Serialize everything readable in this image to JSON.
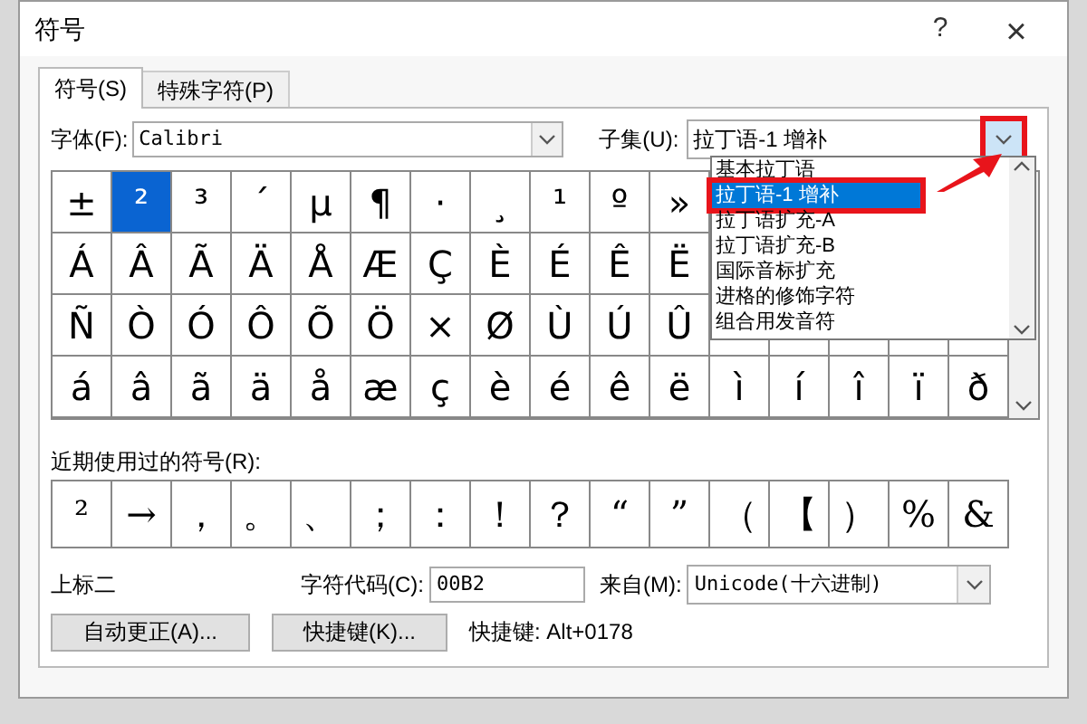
{
  "window": {
    "title": "符号",
    "help": "?",
    "close": "×"
  },
  "tabs": [
    {
      "label": "符号(S)",
      "selected": true
    },
    {
      "label": "特殊字符(P)",
      "selected": false
    }
  ],
  "font": {
    "label": "字体(F):",
    "value": "Calibri"
  },
  "subset": {
    "label": "子集(U):",
    "value": "拉丁语-1 增补",
    "expanded": true,
    "options": [
      {
        "label": "基本拉丁语",
        "selected": false
      },
      {
        "label": "拉丁语-1 增补",
        "selected": true
      },
      {
        "label": "拉丁语扩充-A",
        "selected": false
      },
      {
        "label": "拉丁语扩充-B",
        "selected": false
      },
      {
        "label": "国际音标扩充",
        "selected": false
      },
      {
        "label": "进格的修饰字符",
        "selected": false
      },
      {
        "label": "组合用发音符",
        "selected": false
      }
    ]
  },
  "symbol_grid": {
    "rows": [
      [
        {
          "c": "±",
          "selected": false
        },
        {
          "c": "²",
          "selected": true
        },
        {
          "c": "³",
          "selected": false
        },
        {
          "c": "´",
          "selected": false
        },
        {
          "c": "µ",
          "selected": false
        },
        {
          "c": "¶",
          "selected": false
        },
        {
          "c": "·",
          "selected": false
        },
        {
          "c": "¸",
          "selected": false
        },
        {
          "c": "¹",
          "selected": false
        },
        {
          "c": "º",
          "selected": false
        },
        {
          "c": "»",
          "selected": false
        }
      ],
      [
        {
          "c": "Á",
          "selected": false
        },
        {
          "c": "Â",
          "selected": false
        },
        {
          "c": "Ã",
          "selected": false
        },
        {
          "c": "Ä",
          "selected": false
        },
        {
          "c": "Å",
          "selected": false
        },
        {
          "c": "Æ",
          "selected": false
        },
        {
          "c": "Ç",
          "selected": false
        },
        {
          "c": "È",
          "selected": false
        },
        {
          "c": "É",
          "selected": false
        },
        {
          "c": "Ê",
          "selected": false
        },
        {
          "c": "Ë",
          "selected": false
        }
      ],
      [
        {
          "c": "Ñ",
          "selected": false
        },
        {
          "c": "Ò",
          "selected": false
        },
        {
          "c": "Ó",
          "selected": false
        },
        {
          "c": "Ô",
          "selected": false
        },
        {
          "c": "Õ",
          "selected": false
        },
        {
          "c": "Ö",
          "selected": false
        },
        {
          "c": "×",
          "selected": false
        },
        {
          "c": "Ø",
          "selected": false
        },
        {
          "c": "Ù",
          "selected": false
        },
        {
          "c": "Ú",
          "selected": false
        },
        {
          "c": "Û",
          "selected": false
        }
      ],
      [
        {
          "c": "á",
          "selected": false
        },
        {
          "c": "â",
          "selected": false
        },
        {
          "c": "ã",
          "selected": false
        },
        {
          "c": "ä",
          "selected": false
        },
        {
          "c": "å",
          "selected": false
        },
        {
          "c": "æ",
          "selected": false
        },
        {
          "c": "ç",
          "selected": false
        },
        {
          "c": "è",
          "selected": false
        },
        {
          "c": "é",
          "selected": false
        },
        {
          "c": "ê",
          "selected": false
        },
        {
          "c": "ë",
          "selected": false
        },
        {
          "c": "ì",
          "selected": false
        },
        {
          "c": "í",
          "selected": false
        },
        {
          "c": "î",
          "selected": false
        },
        {
          "c": "ï",
          "selected": false
        },
        {
          "c": "ð",
          "selected": false
        }
      ]
    ]
  },
  "recent": {
    "label": "近期使用过的符号(R):",
    "symbols": [
      "²",
      "→",
      "，",
      "。",
      "、",
      "；",
      "：",
      "！",
      "？",
      "“",
      "”",
      "（",
      "【",
      "）",
      "%",
      "&"
    ]
  },
  "character_name": "上标二",
  "char_code": {
    "label": "字符代码(C):",
    "value": "00B2"
  },
  "from": {
    "label": "来自(M):",
    "value": "Unicode(十六进制)"
  },
  "buttons": [
    "自动更正(A)...",
    "快捷键(K)..."
  ],
  "shortcut_text": "快捷键: Alt+0178"
}
